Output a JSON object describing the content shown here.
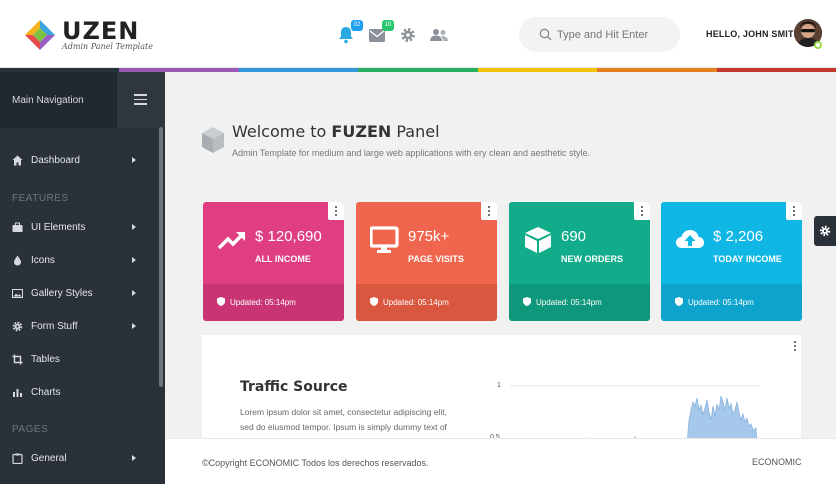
{
  "brand": {
    "name": "UZEN",
    "tagline": "Admin Panel Template"
  },
  "header": {
    "notifications": {
      "icon": "bell-icon",
      "count": "02",
      "color": "#1e9ff2"
    },
    "messages": {
      "icon": "envelope-icon",
      "count": "10",
      "color": "#28c76f"
    },
    "settings_icon": "gear-icon",
    "users_icon": "users-icon",
    "search": {
      "placeholder": "Type and Hit Enter",
      "icon": "search-icon"
    },
    "user": {
      "name": "HELLO, JOHN SMITH!",
      "avatar": "avatar"
    }
  },
  "color_bar": [
    "#26323c",
    "#9b59b6",
    "#3498db",
    "#27ae60",
    "#f1c40f",
    "#e67e22",
    "#c0392b"
  ],
  "sidebar": {
    "title": "Main Navigation",
    "toggle_icon": "hamburger-icon",
    "items": [
      {
        "label": "Dashboard",
        "icon": "home-icon",
        "arrow": true
      },
      {
        "section": "FEATURES"
      },
      {
        "label": "UI Elements",
        "icon": "briefcase-icon",
        "arrow": true
      },
      {
        "label": "Icons",
        "icon": "drop-icon",
        "arrow": true
      },
      {
        "label": "Gallery Styles",
        "icon": "image-icon",
        "arrow": true
      },
      {
        "label": "Form Stuff",
        "icon": "cog-icon",
        "arrow": true
      },
      {
        "label": "Tables",
        "icon": "crop-icon",
        "arrow": false
      },
      {
        "label": "Charts",
        "icon": "bar-chart-icon",
        "arrow": false
      },
      {
        "section": "PAGES"
      },
      {
        "label": "General",
        "icon": "clipboard-icon",
        "arrow": true
      }
    ]
  },
  "welcome": {
    "icon": "cube-icon",
    "title_prefix": "Welcome to ",
    "title_bold": "FUZEN",
    "title_suffix": " Panel",
    "subtitle": "Admin Template for medium and large web applications with ery clean and aesthetic style."
  },
  "cards": [
    {
      "value": "$ 120,690",
      "label": "ALL INCOME",
      "icon": "trend-up-icon",
      "updated": "Updated: 05:14pm",
      "color": "#e03e83",
      "dark": "#c93574"
    },
    {
      "value": "975k+",
      "label": "PAGE VISITS",
      "icon": "monitor-icon",
      "updated": "Updated: 05:14pm",
      "color": "#f0654d",
      "dark": "#d9573f"
    },
    {
      "value": "690",
      "label": "NEW ORDERS",
      "icon": "cube-icon",
      "updated": "Updated: 05:14pm",
      "color": "#12ac8a",
      "dark": "#0e977a"
    },
    {
      "value": "$ 2,206",
      "label": "TODAY INCOME",
      "icon": "cloud-upload-icon",
      "updated": "Updated: 05:14pm",
      "color": "#10b7e5",
      "dark": "#0ea3cd"
    }
  ],
  "traffic": {
    "title": "Traffic Source",
    "text": "Lorem ipsum dolor sit amet, consectetur adipiscing elit, sed do eiusmod tempor. Ipsum is simply dummy text of",
    "chart_ticks": [
      "1",
      "0.5"
    ]
  },
  "footer": {
    "copyright": "©Copyright ECONOMIC Todos los derechos reservados.",
    "brand": "ECONOMIC"
  }
}
